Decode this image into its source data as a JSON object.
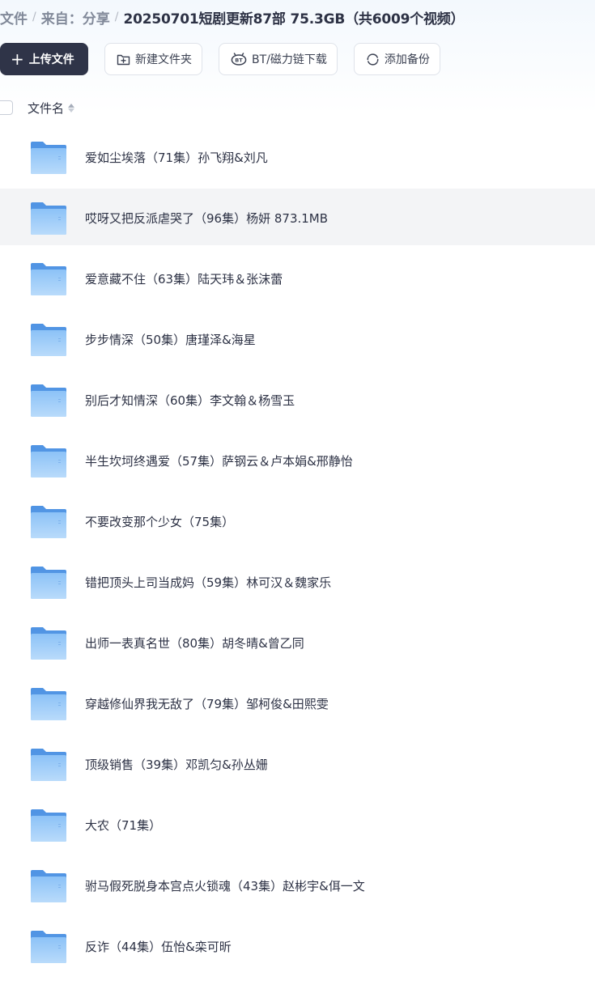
{
  "breadcrumb": {
    "root": "文件",
    "from": "来自：分享",
    "current": "20250701短剧更新87部 75.3GB（共6009个视频）"
  },
  "toolbar": {
    "upload_label": "上传文件",
    "new_folder_label": "新建文件夹",
    "bt_label": "BT/磁力链下载",
    "backup_label": "添加备份"
  },
  "list_header": {
    "name_label": "文件名"
  },
  "files": [
    {
      "name": "爱如尘埃落（71集）孙飞翔&刘凡"
    },
    {
      "name": "哎呀又把反派虐哭了（96集）杨妍 873.1MB",
      "hovered": true
    },
    {
      "name": "爱意藏不住（63集）陆天玮＆张沫蕾"
    },
    {
      "name": "步步情深（50集）唐瑾泽&海星"
    },
    {
      "name": "别后才知情深（60集）李文翰＆杨雪玉"
    },
    {
      "name": "半生坎坷终遇爱（57集）萨钢云＆卢本娟&邢静怡"
    },
    {
      "name": "不要改变那个少女（75集）"
    },
    {
      "name": "错把顶头上司当成妈（59集）林可汉＆魏家乐"
    },
    {
      "name": "出师一表真名世（80集）胡冬晴&曾乙同"
    },
    {
      "name": "穿越修仙界我无敌了（79集）邹柯俊&田熙雯"
    },
    {
      "name": "顶级销售（39集）邓凯匀&孙丛姗"
    },
    {
      "name": "大农（71集）"
    },
    {
      "name": "驸马假死脱身本宫点火锁魂（43集）赵彬宇&佴一文"
    },
    {
      "name": "反诈（44集）伍怡&栾可昕"
    }
  ],
  "colors": {
    "primary_button": "#2f3448",
    "folder_blue": "#6aa8ee",
    "hover_row": "#f3f4f6"
  },
  "icons": {
    "upload": "plus-icon",
    "new_folder": "folder-plus-icon",
    "bt": "bt-icon",
    "backup": "sync-icon",
    "file": "folder-icon",
    "sort": "sort-icon"
  }
}
